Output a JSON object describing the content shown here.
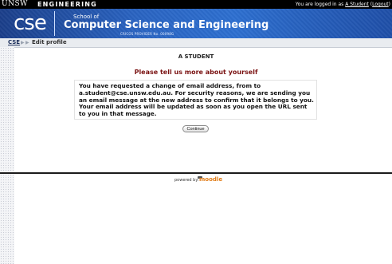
{
  "topbar": {
    "brand_unsw": "UNSW",
    "brand_engineering": "ENGINEERING",
    "logged_in_prefix": "You are logged in as",
    "logged_in_user": "A Student",
    "logout_label": "Logout"
  },
  "banner": {
    "logo_text": "cse",
    "school_of": "School of",
    "school_title": "Computer Science and Engineering",
    "cricos": "CRICOS PROVIDER No. 00098G"
  },
  "breadcrumb": {
    "home": "CSE",
    "current": "Edit profile"
  },
  "main": {
    "student_name": "A STUDENT",
    "heading": "Please tell us more about yourself",
    "message": "You have requested a change of email address, from to a.student@cse.unsw.edu.au. For security reasons, we are sending you an email message at the new address to confirm that it belongs to you. Your email address will be updated as soon as you open the URL sent to you in that message.",
    "continue_label": "Continue"
  },
  "footer": {
    "powered_by": "powered by:",
    "moodle": "moodle"
  },
  "colors": {
    "banner_blue": "#2a64c2",
    "heading_red": "#7a1212",
    "moodle_orange": "#e07b15"
  }
}
